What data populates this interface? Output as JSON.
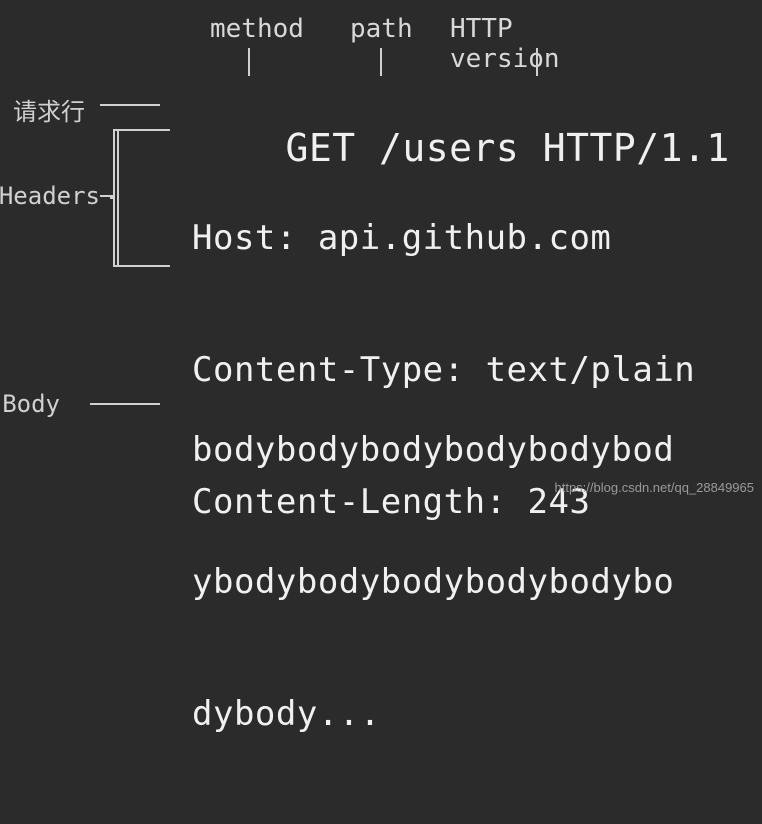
{
  "top_labels": {
    "method": "method",
    "path": "path",
    "version": "HTTP version"
  },
  "side_labels": {
    "request_line": "请求行",
    "headers": "Headers",
    "body": "Body"
  },
  "request_line": {
    "method": "GET",
    "path": "/users",
    "version": "HTTP/1.1"
  },
  "headers": [
    "Host: api.github.com",
    "Content-Type: text/plain",
    "Content-Length: 243"
  ],
  "body_lines": [
    "bodybodybodybodybodybod",
    "ybodybodybodybodybodybo",
    "dybody..."
  ],
  "watermark": "https://blog.csdn.net/qq_28849965"
}
